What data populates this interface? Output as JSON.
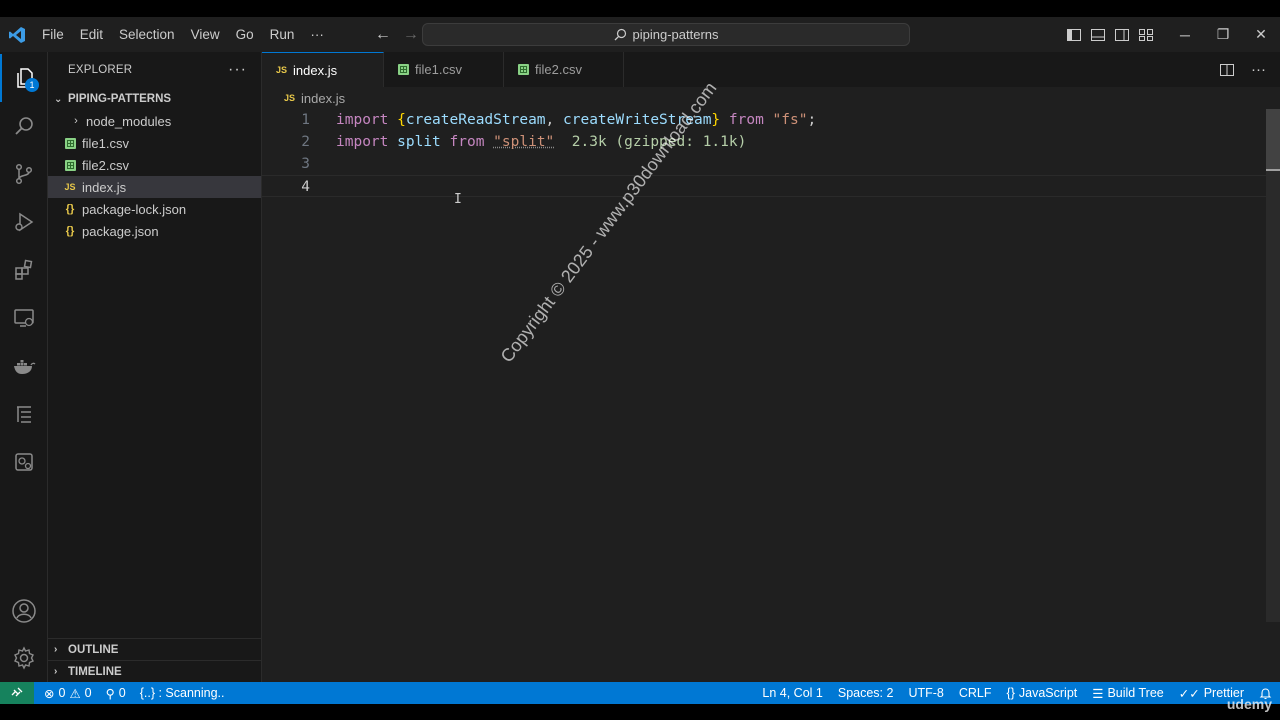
{
  "window": {
    "search_text": "piping-patterns",
    "menu": [
      "File",
      "Edit",
      "Selection",
      "View",
      "Go",
      "Run",
      "···"
    ]
  },
  "activity_bar": {
    "items": [
      "explorer-icon",
      "search-icon",
      "source-control-icon",
      "run-debug-icon",
      "extensions-icon",
      "remote-explorer-icon",
      "docker-icon",
      "outline-view-icon",
      "settings-sync-icon"
    ],
    "badge": "1",
    "bottom": [
      "account-icon",
      "manage-gear-icon"
    ]
  },
  "sidebar": {
    "title": "EXPLORER",
    "more": "···",
    "folder": "PIPING-PATTERNS",
    "items": [
      {
        "label": "node_modules",
        "type": "folder"
      },
      {
        "label": "file1.csv",
        "type": "csv"
      },
      {
        "label": "file2.csv",
        "type": "csv"
      },
      {
        "label": "index.js",
        "type": "js"
      },
      {
        "label": "package-lock.json",
        "type": "json"
      },
      {
        "label": "package.json",
        "type": "json"
      }
    ],
    "outline": "OUTLINE",
    "timeline": "TIMELINE"
  },
  "tabs": [
    {
      "label": "index.js",
      "type": "js",
      "active": true,
      "dirty": true
    },
    {
      "label": "file1.csv",
      "type": "csv"
    },
    {
      "label": "file2.csv",
      "type": "csv"
    }
  ],
  "editor": {
    "breadcrumb": "index.js",
    "line_numbers": [
      "1",
      "2",
      "3",
      "4"
    ],
    "line1": {
      "kw1": "import",
      "b_open": "{",
      "v1": "createReadStream",
      "comma": ", ",
      "v2": "createWriteStream",
      "b_close": "}",
      "kw2": "from",
      "str": "\"fs\"",
      "semi": ";"
    },
    "line2": {
      "kw1": "import",
      "v1": "split",
      "kw2": "from",
      "str": "\"split\"",
      "size_hint": "2.3k (gzipped: 1.1k)"
    },
    "cursor_glyph": "I",
    "accent_color": "#0078d4"
  },
  "watermark": "Copyright © 2025 - www.p30download.com",
  "statusbar": {
    "errors": "0",
    "warnings": "0",
    "ports": "0",
    "scanning": "{..} : Scanning..",
    "position": "Ln 4, Col 1",
    "spaces": "Spaces: 2",
    "encoding": "UTF-8",
    "eol": "CRLF",
    "language": "JavaScript",
    "build_tree": "Build Tree",
    "prettier": "Prettier"
  },
  "overlay_brand": "udemy"
}
